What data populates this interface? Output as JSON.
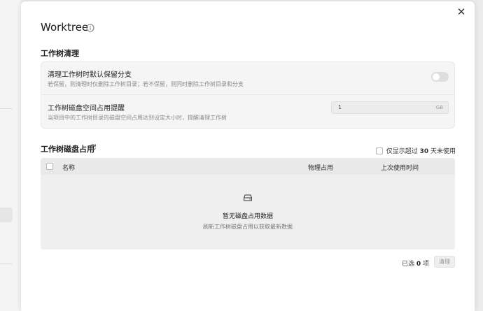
{
  "modal": {
    "title": "Worktree",
    "close_glyph": "✕"
  },
  "cleanup": {
    "section_title": "工作树清理",
    "keep_branch": {
      "title": "清理工作树时默认保留分支",
      "description": "若保留，则清理时仅删除工作树目录；若不保留，则同时删除工作树目录和分支",
      "enabled": false
    },
    "disk_alert": {
      "title": "工作树磁盘空间占用提醒",
      "description": "当项目中的工作树目录的磁盘空间占用达到设定大小时，提醒清理工作树",
      "value": "1",
      "unit": "GB"
    }
  },
  "usage": {
    "section_title": "工作树磁盘占用",
    "filter_prefix": "仅显示超过",
    "filter_days": "30",
    "filter_suffix": "天未使用",
    "columns": {
      "name": "名称",
      "physical": "物理占用",
      "last_used": "上次使用时间"
    },
    "empty_title": "暂无磁盘占用数据",
    "empty_desc": "刷新工作树磁盘占用以获取最新数据"
  },
  "footer": {
    "selected_prefix": "已选",
    "selected_count": "0",
    "selected_suffix": "项",
    "clear_label": "清理"
  },
  "icons": {
    "close": "close-icon",
    "info": "info-icon",
    "refresh": "refresh-icon",
    "empty": "drive-icon"
  },
  "colors": {
    "modal_bg": "#ffffff",
    "panel_bg": "#f5f5f5",
    "table_bg": "#efefef"
  }
}
